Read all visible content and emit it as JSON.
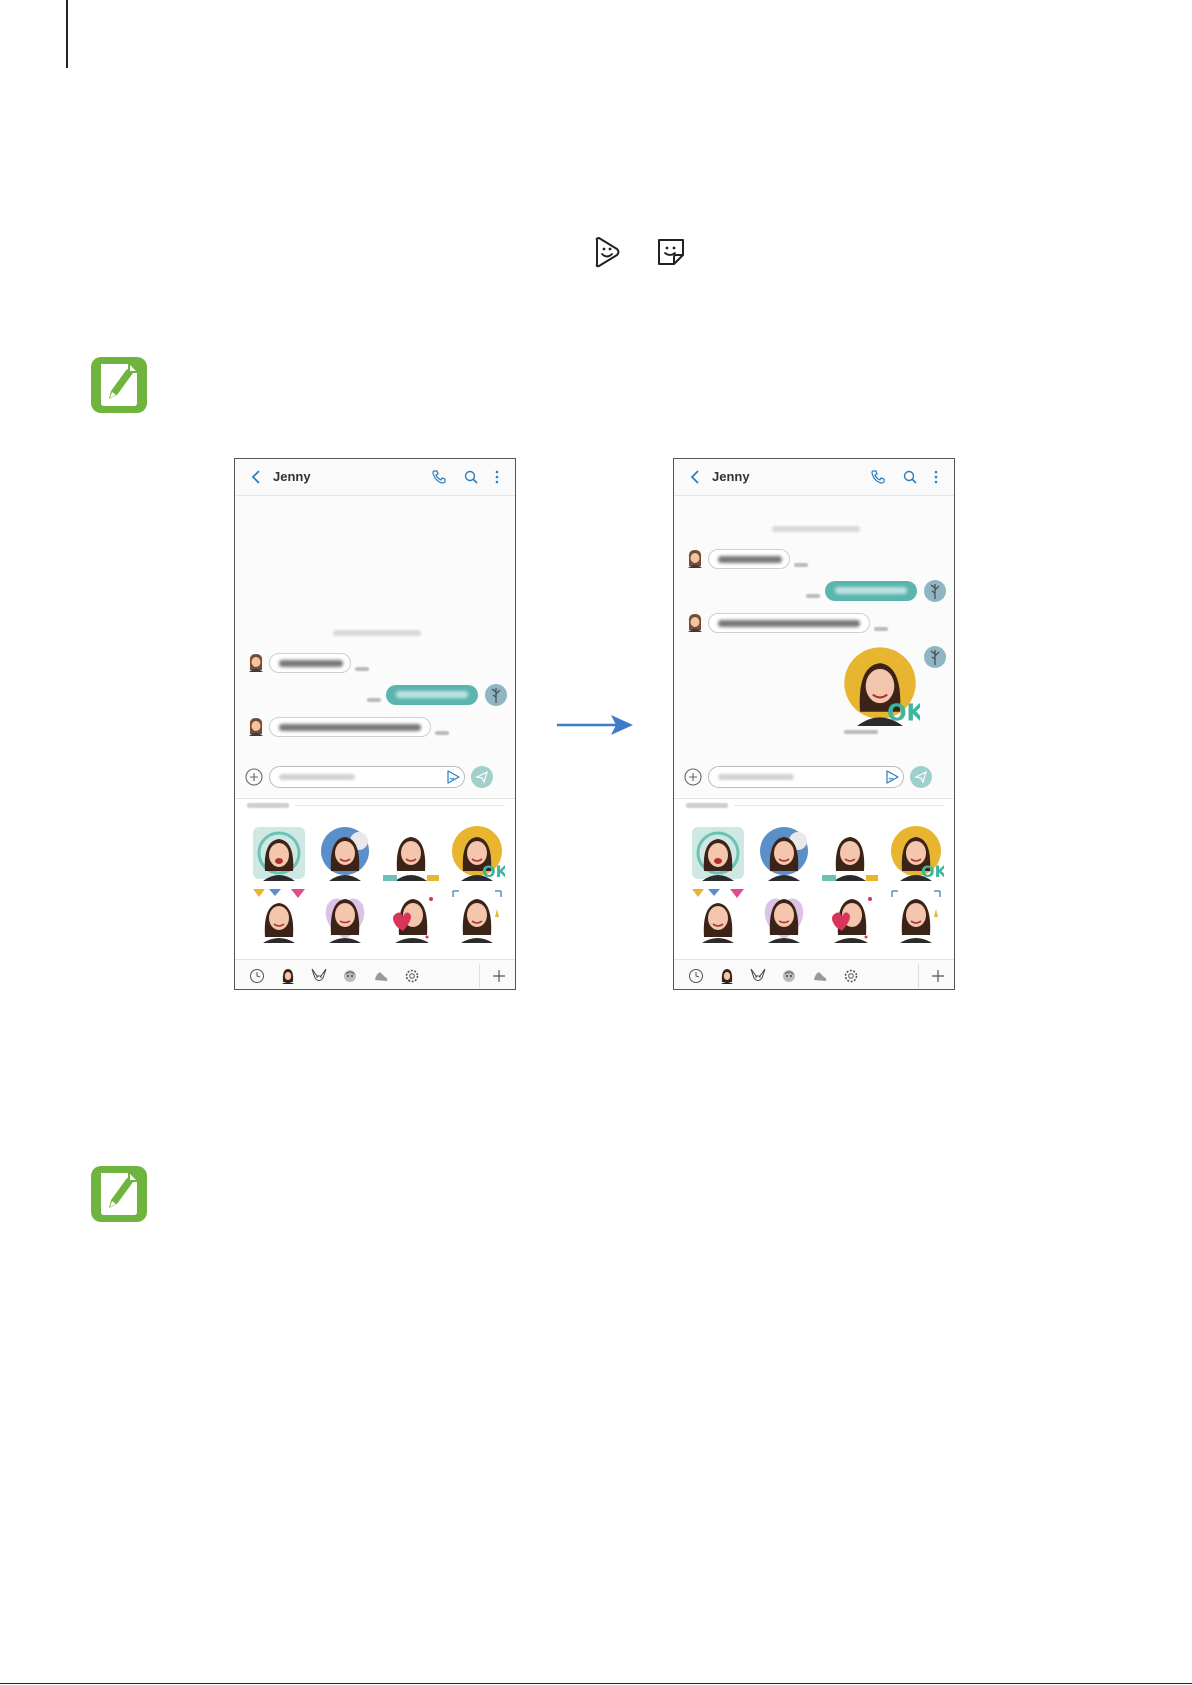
{
  "left_chat": {
    "contact_name": "Jenny"
  },
  "right_chat": {
    "contact_name": "Jenny"
  },
  "icons": {
    "back": "chevron-left-icon",
    "call": "phone-icon",
    "search": "search-icon",
    "more": "more-vert-icon",
    "attach": "plus-circle-icon",
    "sticker_button": "sticker-play-icon",
    "send": "send-icon",
    "note": "note-pencil-icon",
    "inline_ar_emoji": "ar-emoji-icon",
    "inline_sticker": "sticker-icon",
    "arrow": "right-arrow-icon"
  },
  "colors": {
    "accent": "#5ab5af",
    "note_green": "#6fb43f",
    "arrow_blue": "#3d7cc9"
  }
}
